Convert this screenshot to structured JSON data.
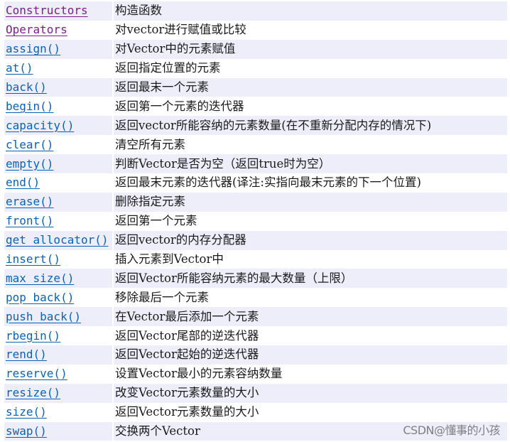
{
  "table": {
    "rows": [
      {
        "name": "Constructors",
        "desc": "构造函数",
        "visited": true
      },
      {
        "name": "Operators",
        "desc": "对vector进行赋值或比较",
        "visited": true
      },
      {
        "name": "assign()",
        "desc": "对Vector中的元素赋值",
        "visited": false
      },
      {
        "name": "at()",
        "desc": "返回指定位置的元素",
        "visited": false
      },
      {
        "name": "back()",
        "desc": "返回最末一个元素",
        "visited": false
      },
      {
        "name": "begin()",
        "desc": "返回第一个元素的迭代器",
        "visited": false
      },
      {
        "name": "capacity()",
        "desc": "返回vector所能容纳的元素数量(在不重新分配内存的情况下)",
        "visited": false
      },
      {
        "name": "clear()",
        "desc": "清空所有元素",
        "visited": false
      },
      {
        "name": "empty()",
        "desc": "判断Vector是否为空（返回true时为空）",
        "visited": false
      },
      {
        "name": "end()",
        "desc": "返回最末元素的迭代器(译注:实指向最末元素的下一个位置)",
        "visited": false
      },
      {
        "name": "erase()",
        "desc": "删除指定元素",
        "visited": false
      },
      {
        "name": "front()",
        "desc": "返回第一个元素",
        "visited": false
      },
      {
        "name": "get_allocator()",
        "desc": "返回vector的内存分配器",
        "visited": false
      },
      {
        "name": "insert()",
        "desc": "插入元素到Vector中",
        "visited": false
      },
      {
        "name": "max_size()",
        "desc": "返回Vector所能容纳元素的最大数量（上限）",
        "visited": false
      },
      {
        "name": "pop_back()",
        "desc": "移除最后一个元素",
        "visited": false
      },
      {
        "name": "push_back()",
        "desc": "在Vector最后添加一个元素",
        "visited": false
      },
      {
        "name": "rbegin()",
        "desc": "返回Vector尾部的逆迭代器",
        "visited": false
      },
      {
        "name": "rend()",
        "desc": "返回Vector起始的逆迭代器",
        "visited": false
      },
      {
        "name": "reserve()",
        "desc": "设置Vector最小的元素容纳数量",
        "visited": false
      },
      {
        "name": "resize()",
        "desc": "改变Vector元素数量的大小",
        "visited": false
      },
      {
        "name": "size()",
        "desc": "返回Vector元素数量的大小",
        "visited": false
      },
      {
        "name": "swap()",
        "desc": "交换两个Vector",
        "visited": false
      }
    ]
  },
  "colors": {
    "link": "#0b61b6",
    "link_visited": "#7b1e8c",
    "row_alt": "#eeeefb"
  },
  "watermark": "CSDN@懂事的小孩"
}
